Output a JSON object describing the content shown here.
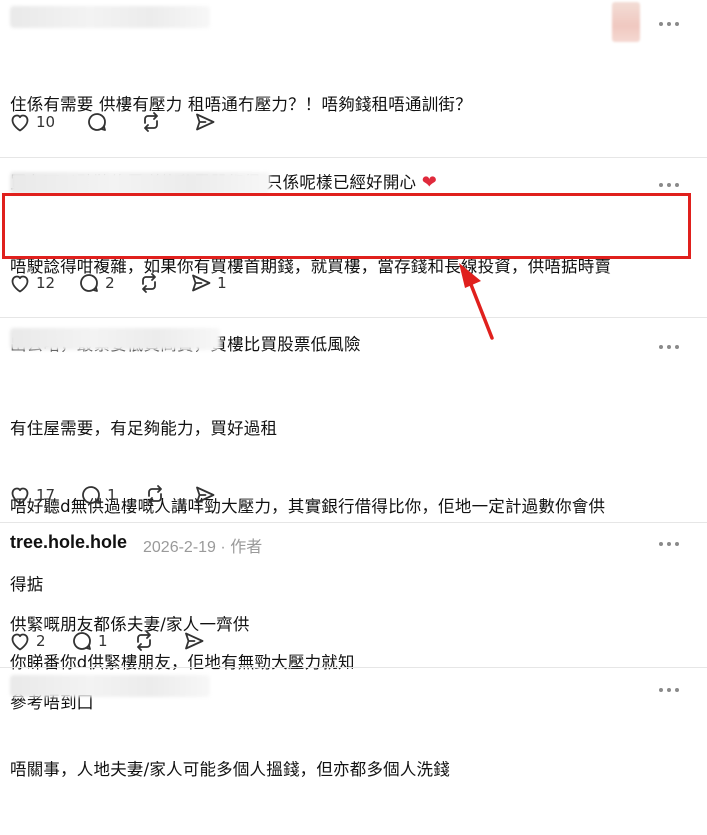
{
  "posts": [
    {
      "lines": [
        "住係有需要 供樓有壓力 租唔通冇壓力？！唔夠錢租唔通訓街？",
        "買左可以點裝修買咩傢私電器都得 只係呢樣已經好開心"
      ],
      "emoji": "❤",
      "likes": "10",
      "replies": "",
      "reposts": ""
    },
    {
      "lines": [
        "唔駛諗得咁複雜，如果你有買樓首期錢，就買樓，當存錢和長線投資，供唔掂時賣",
        "出去咯，最緊要低買高賣，買樓比買股票低風險"
      ],
      "likes": "12",
      "replies": "2",
      "reposts": "",
      "shares": "1"
    },
    {
      "lines": [
        "有住屋需要，有足夠能力，買好過租",
        "唔好聽d無供過樓嘅人講咩勁大壓力，其實銀行借得比你，佢地一定計過數你會供",
        "得掂",
        "你睇番你d供緊樓朋友，佢地有無勁大壓力就知"
      ],
      "likes": "17",
      "replies": "1",
      "reposts": ""
    },
    {
      "username": "tree.hole.hole",
      "date": "2026-2-19",
      "separator": "·",
      "author_tag": "作者",
      "lines": [
        "供緊嘅朋友都係夫妻/家人一齊供",
        "參考唔到囗"
      ],
      "likes": "2",
      "replies": "1",
      "reposts": ""
    },
    {
      "lines": [
        "唔關事，人地夫妻/家人可能多個人搵錢，但亦都多個人洗錢"
      ]
    }
  ],
  "colors": {
    "highlight": "#e0201d",
    "text": "#111111",
    "muted": "#9a9a9a",
    "icon": "#333333"
  },
  "icons": [
    "heart-icon",
    "reply-icon",
    "repost-icon",
    "share-icon",
    "more-icon"
  ]
}
